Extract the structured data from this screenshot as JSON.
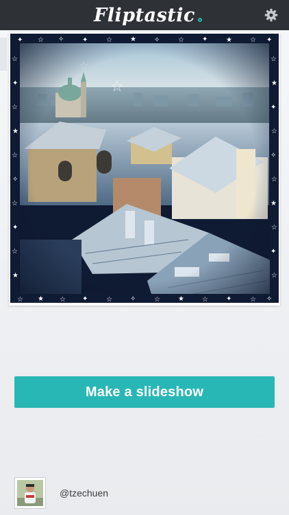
{
  "app": {
    "logo_text": "Fliptastic",
    "brand_color": "#29b7b5",
    "header_color": "#2e3236"
  },
  "header": {
    "settings_icon": "gear-icon"
  },
  "photo": {
    "subject": "Snowy rooftops of a European city with a domed church, framed by a starry night border"
  },
  "cta": {
    "label": "Make a slideshow"
  },
  "author": {
    "username": "@tzechuen"
  }
}
